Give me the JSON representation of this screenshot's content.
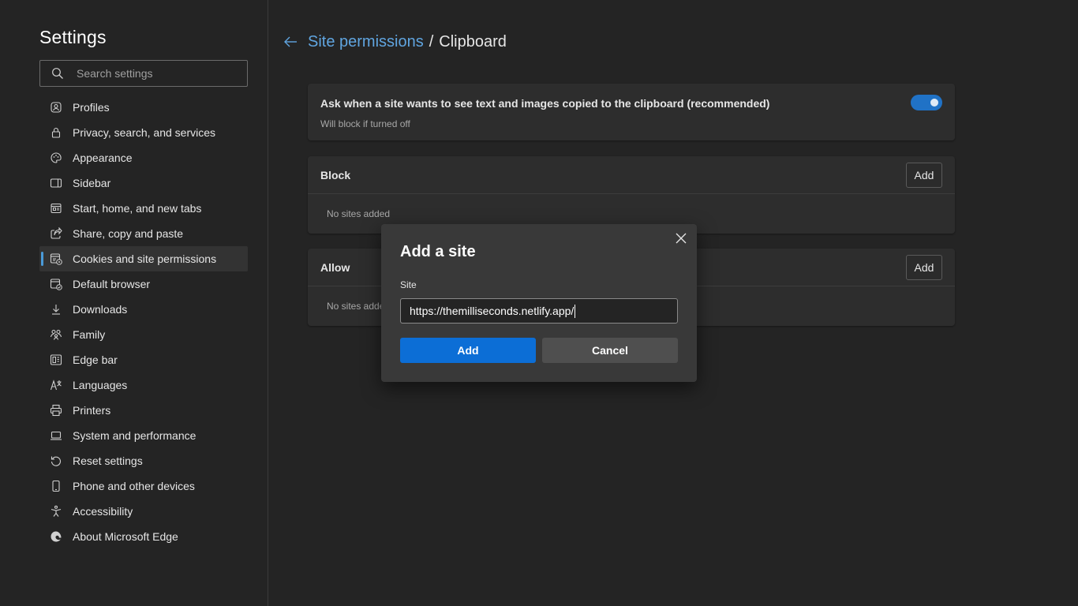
{
  "sidebar": {
    "title": "Settings",
    "search_placeholder": "Search settings",
    "items": [
      {
        "label": "Profiles",
        "icon": "profile-icon"
      },
      {
        "label": "Privacy, search, and services",
        "icon": "lock-icon"
      },
      {
        "label": "Appearance",
        "icon": "palette-icon"
      },
      {
        "label": "Sidebar",
        "icon": "sidebar-icon"
      },
      {
        "label": "Start, home, and new tabs",
        "icon": "home-tabs-icon"
      },
      {
        "label": "Share, copy and paste",
        "icon": "share-icon"
      },
      {
        "label": "Cookies and site permissions",
        "icon": "cookies-permissions-icon",
        "active": true
      },
      {
        "label": "Default browser",
        "icon": "default-browser-icon"
      },
      {
        "label": "Downloads",
        "icon": "download-icon"
      },
      {
        "label": "Family",
        "icon": "family-icon"
      },
      {
        "label": "Edge bar",
        "icon": "edge-bar-icon"
      },
      {
        "label": "Languages",
        "icon": "languages-icon"
      },
      {
        "label": "Printers",
        "icon": "printer-icon"
      },
      {
        "label": "System and performance",
        "icon": "laptop-icon"
      },
      {
        "label": "Reset settings",
        "icon": "reset-icon"
      },
      {
        "label": "Phone and other devices",
        "icon": "phone-icon"
      },
      {
        "label": "Accessibility",
        "icon": "accessibility-icon"
      },
      {
        "label": "About Microsoft Edge",
        "icon": "edge-logo-icon"
      }
    ]
  },
  "header": {
    "parent": "Site permissions",
    "separator": "/",
    "current": "Clipboard"
  },
  "ask_card": {
    "title": "Ask when a site wants to see text and images copied to the clipboard (recommended)",
    "subtitle": "Will block if turned off",
    "toggle_on": true
  },
  "block_card": {
    "label": "Block",
    "add_label": "Add",
    "empty_text": "No sites added"
  },
  "allow_card": {
    "label": "Allow",
    "add_label": "Add",
    "empty_text": "No sites added"
  },
  "dialog": {
    "title": "Add a site",
    "field_label": "Site",
    "field_value": "https://themilliseconds.netlify.app/",
    "add_label": "Add",
    "cancel_label": "Cancel"
  },
  "colors": {
    "background": "#242424",
    "card": "#2d2d2d",
    "dialog": "#393939",
    "accent": "#0c6ed6",
    "link": "#60a5e0"
  }
}
